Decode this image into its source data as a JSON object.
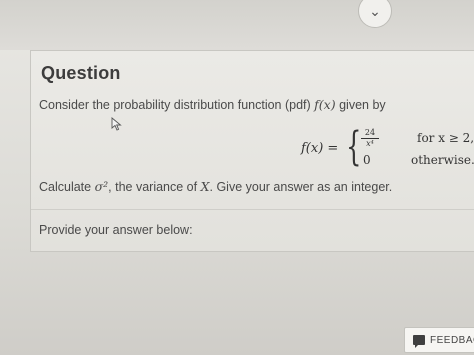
{
  "question": {
    "title": "Question",
    "prompt_prefix": "Consider the probability distribution function (pdf)",
    "prompt_func": "f(x)",
    "prompt_suffix": "given by",
    "equation": {
      "lhs": "f(x) =",
      "case1_num": "24",
      "case1_den": "x⁴",
      "case1_cond": "for x ≥ 2,",
      "case2_val": "0",
      "case2_cond": "otherwise."
    },
    "calc_prefix": "Calculate",
    "calc_symbol": "σ²",
    "calc_middle": ", the variance of",
    "calc_var": "X",
    "calc_suffix": ". Give your answer as an integer.",
    "answer_label": "Provide your answer below:"
  },
  "buttons": {
    "collapse_icon": "⌄",
    "feedback_label": "FEEDBAC"
  },
  "icons": {
    "collapse": "chevron-down-icon",
    "cursor": "mouse-cursor-icon",
    "feedback": "speech-bubble-icon"
  }
}
